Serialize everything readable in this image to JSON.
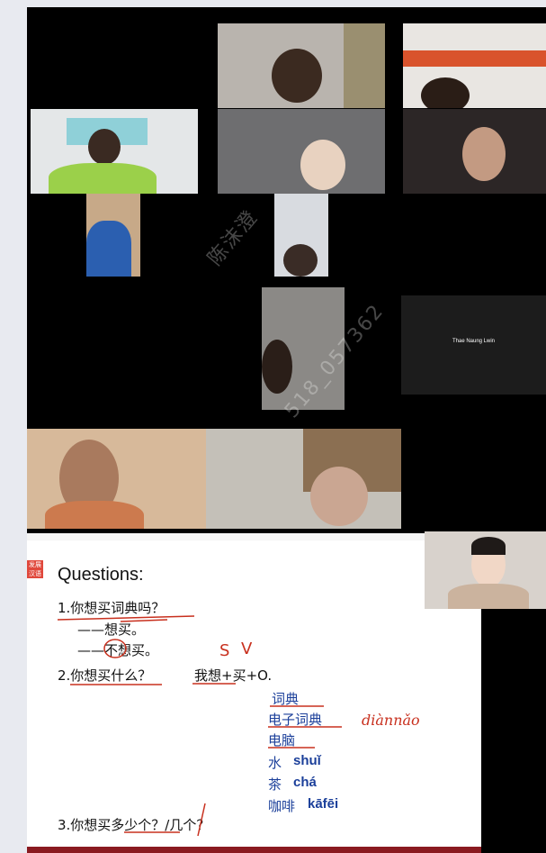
{
  "watermarks": [
    "陈沫澄",
    "518_057362"
  ],
  "participants": {
    "name_tile_label": "Thae Naung Lwin"
  },
  "slide": {
    "logo_text": "发展汉语",
    "title": "Questions:",
    "q1": "1.你想买词典吗？",
    "q1_a1": "——想买。",
    "q1_a2": "——不想买。",
    "q2": "2.你想买什么？",
    "q2_formula": "我想+买+O.",
    "options": [
      {
        "hanzi": "词典",
        "pinyin": ""
      },
      {
        "hanzi": "电子词典",
        "pinyin": ""
      },
      {
        "hanzi": "电脑",
        "pinyin": ""
      },
      {
        "hanzi": "水",
        "pinyin": "shuǐ"
      },
      {
        "hanzi": "茶",
        "pinyin": "chá"
      },
      {
        "hanzi": "咖啡",
        "pinyin": "kāfēi"
      }
    ],
    "handwriting_pinyin": "diànnǎo",
    "handwriting_s": "S",
    "handwriting_v": "V",
    "q3": "3.你想买多少个？/几个？"
  },
  "colors": {
    "accent_red": "#c8301e",
    "text_blue": "#1b3f9a"
  }
}
